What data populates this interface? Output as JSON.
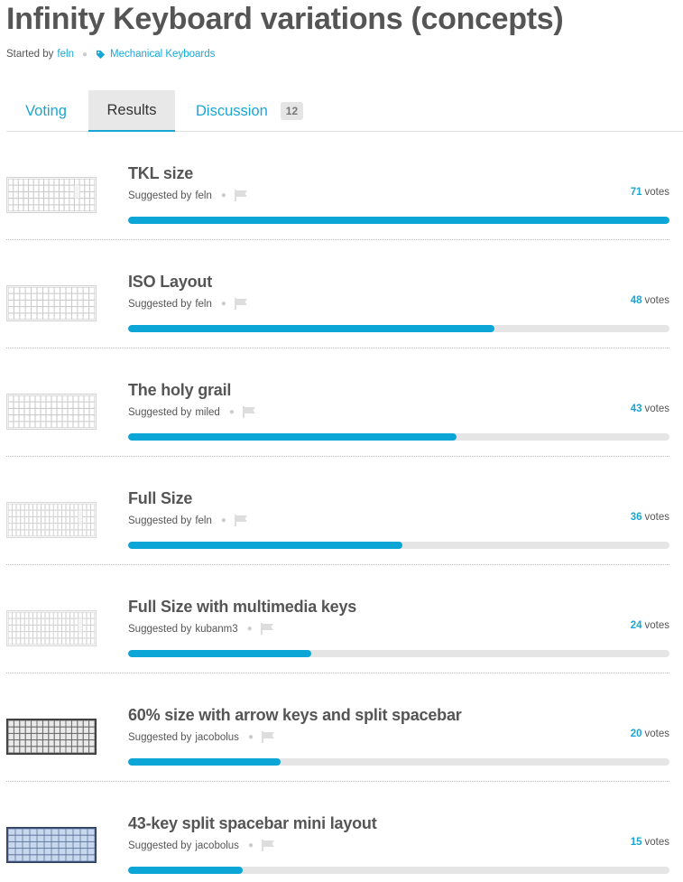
{
  "page": {
    "title": "Infinity Keyboard variations (concepts)"
  },
  "meta": {
    "started_by_label": "Started by",
    "author": "feln",
    "category": "Mechanical Keyboards"
  },
  "tabs": [
    {
      "label": "Voting"
    },
    {
      "label": "Results",
      "active": true
    },
    {
      "label": "Discussion",
      "badge": "12"
    }
  ],
  "colors": {
    "accent": "#0ca6d6",
    "link": "#1aa6d4",
    "track": "#e5e5e5",
    "text": "#555555"
  },
  "results": [
    {
      "title": "TKL size",
      "suggested_label": "Suggested by",
      "suggested_by": "feln",
      "votes": "71",
      "votes_label": "votes",
      "share": 1.0,
      "thumb": "tkl-light"
    },
    {
      "title": "ISO Layout",
      "suggested_label": "Suggested by",
      "suggested_by": "feln",
      "votes": "48",
      "votes_label": "votes",
      "share": 0.676,
      "thumb": "iso-light"
    },
    {
      "title": "The holy grail",
      "suggested_label": "Suggested by",
      "suggested_by": "miled",
      "votes": "43",
      "votes_label": "votes",
      "share": 0.606,
      "thumb": "grail-light"
    },
    {
      "title": "Full Size",
      "suggested_label": "Suggested by",
      "suggested_by": "feln",
      "votes": "36",
      "votes_label": "votes",
      "share": 0.507,
      "thumb": "fullsize-light"
    },
    {
      "title": "Full Size with multimedia keys",
      "suggested_label": "Suggested by",
      "suggested_by": "kubanm3",
      "votes": "24",
      "votes_label": "votes",
      "share": 0.338,
      "thumb": "fullsize-light"
    },
    {
      "title": "60% size with arrow keys and split spacebar",
      "suggested_label": "Suggested by",
      "suggested_by": "jacobolus",
      "votes": "20",
      "votes_label": "votes",
      "share": 0.282,
      "thumb": "sixty-dark"
    },
    {
      "title": "43-key split spacebar mini layout",
      "suggested_label": "Suggested by",
      "suggested_by": "jacobolus",
      "votes": "15",
      "votes_label": "votes",
      "share": 0.211,
      "thumb": "mini-blue"
    }
  ]
}
